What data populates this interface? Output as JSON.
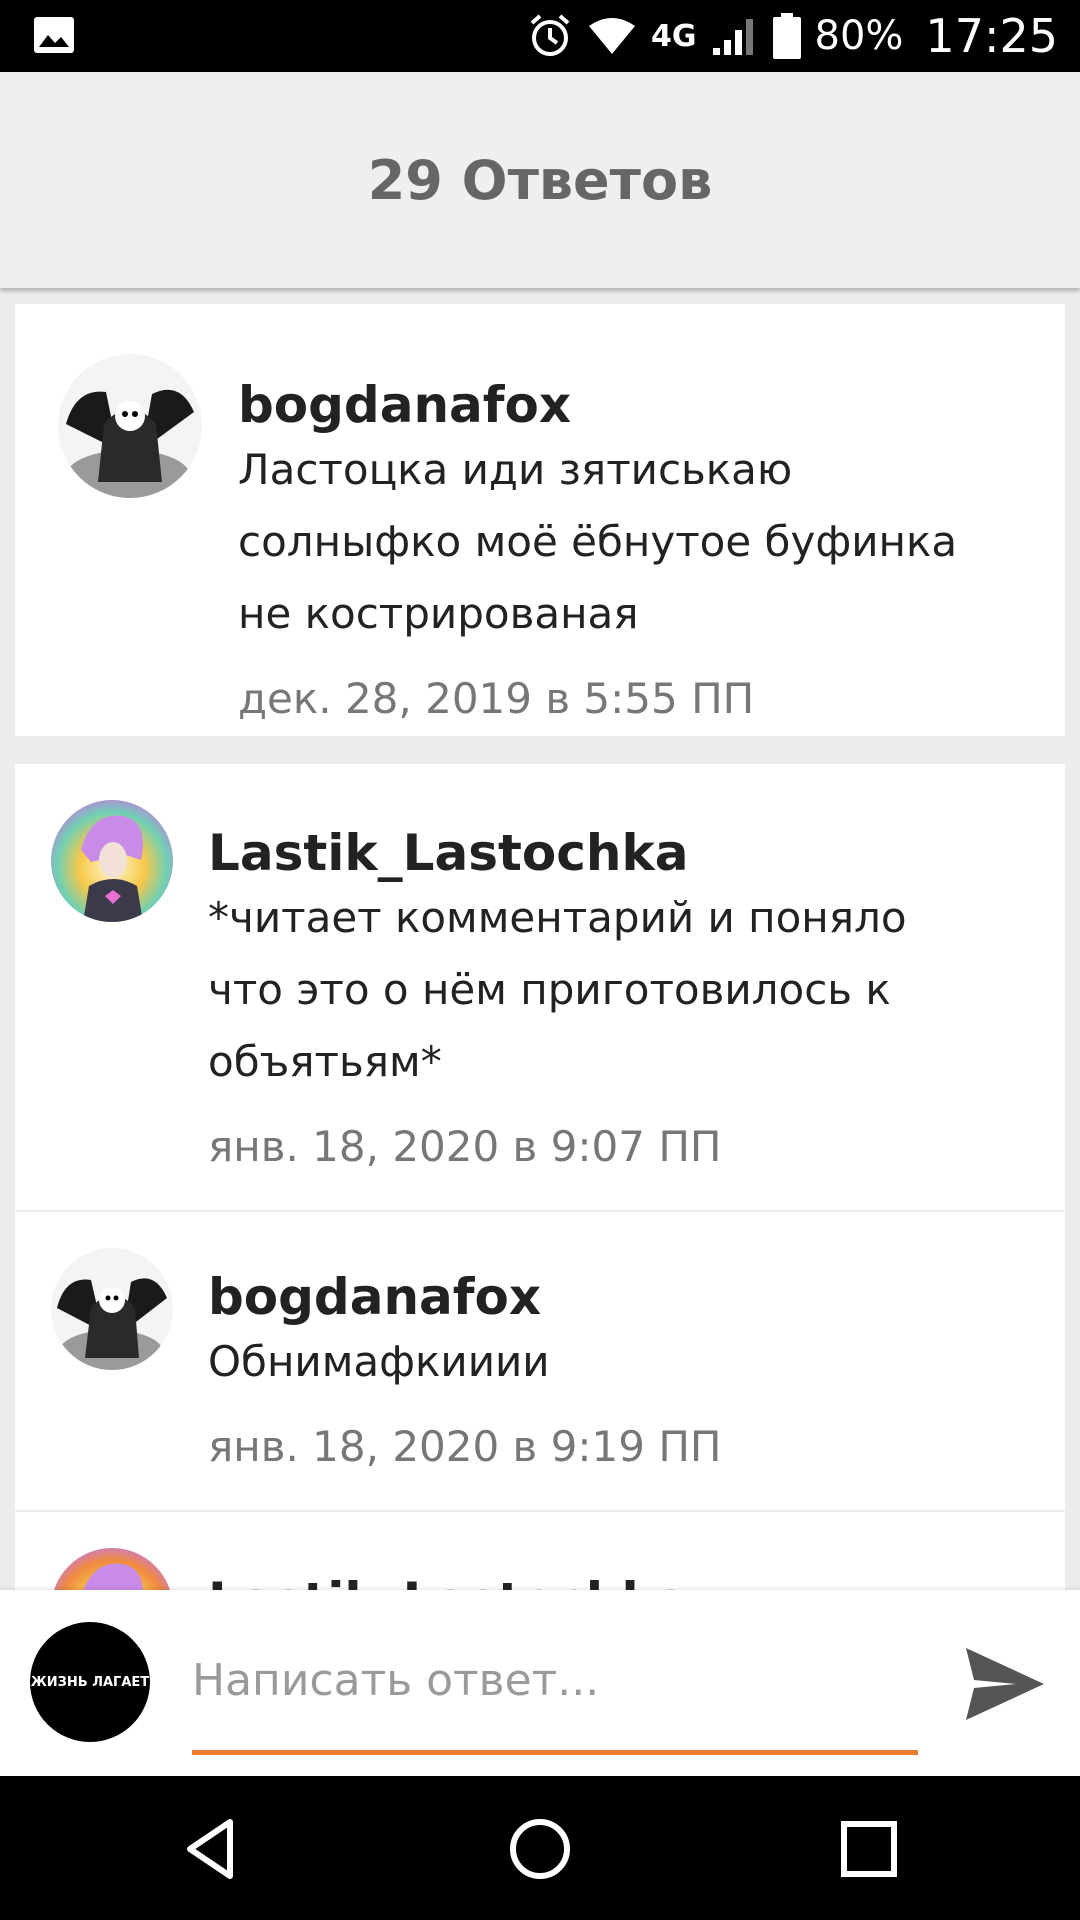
{
  "status_bar": {
    "battery": "80%",
    "time": "17:25",
    "network": "4G",
    "icons": [
      "gallery-icon",
      "alarm-icon",
      "wifi-icon",
      "signal-icon",
      "battery-icon"
    ]
  },
  "header": {
    "title": "29 Ответов"
  },
  "comments": [
    {
      "username": "bogdanafox",
      "lines": [
        "Ластоцка иди зятиськаю",
        "солныфко моё ёбнутое буфинка",
        "не кострированая"
      ],
      "date": "дек. 28, 2019 в 5:55 ПП"
    },
    {
      "username": "Lastik_Lastochka",
      "lines": [
        "*читает комментарий и поняло",
        "что это о нём приготовилось к",
        "объятьям*"
      ],
      "date": "янв. 18, 2020 в 9:07 ПП"
    },
    {
      "username": "bogdanafox",
      "lines": [
        "Обнимафкииии"
      ],
      "date": "янв. 18, 2020 в 9:19 ПП"
    },
    {
      "username": "Lastik_Lastochka",
      "lines": [],
      "date": ""
    }
  ],
  "reply": {
    "avatar_text": "ЖИЗНЬ ЛАГАЕТ",
    "placeholder": "Написать ответ...",
    "accent_color": "#f07a2e"
  },
  "nav": {
    "icons": [
      "back-icon",
      "home-icon",
      "recents-icon"
    ]
  }
}
